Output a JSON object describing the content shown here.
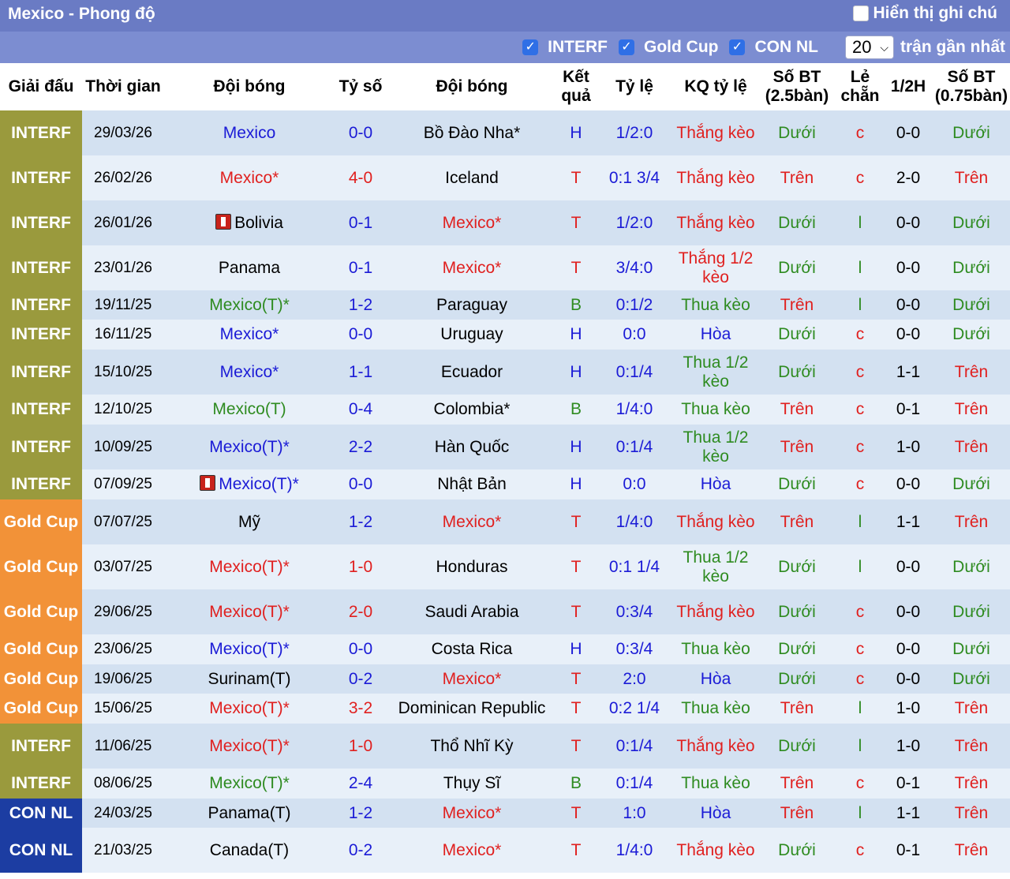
{
  "header": {
    "title": "Mexico - Phong độ",
    "notes_label": "Hiển thị ghi chú"
  },
  "filters": [
    {
      "label": "INTERF",
      "checked": true
    },
    {
      "label": "Gold Cup",
      "checked": true
    },
    {
      "label": "CON NL",
      "checked": true
    }
  ],
  "count": {
    "value": "20",
    "label": "trận gần nhất"
  },
  "columns": [
    "Giải đấu",
    "Thời gian",
    "Đội bóng",
    "Tỷ số",
    "Đội bóng",
    "Kết quả",
    "Tỷ lệ",
    "KQ tỷ lệ",
    "Số BT (2.5bàn)",
    "Lẻ chẵn",
    "1/2H",
    "Số BT (0.75bàn)"
  ],
  "colors": {
    "interf": "#9a9a3d",
    "gold": "#f29238",
    "connl": "#1c3da2",
    "blue": "#1b1bd6",
    "red": "#e0201f",
    "green": "#2e8b20"
  },
  "rows": [
    {
      "comp": "INTERF",
      "date": "29/03/26",
      "home": "Mexico",
      "home_color": "blue",
      "score": "0-0",
      "score_color": "blue",
      "away": "Bồ Đào Nha*",
      "away_color": "black",
      "result": "H",
      "result_color": "blue",
      "odds": "1/2:0",
      "odds_color": "blue",
      "ah": "Thắng kèo",
      "ah_color": "red",
      "ou": "Dưới",
      "ou_color": "green",
      "oe": "c",
      "oe_color": "red",
      "ht": "0-0",
      "ou2": "Dưới",
      "ou2_color": "green"
    },
    {
      "comp": "INTERF",
      "date": "26/02/26",
      "home": "Mexico*",
      "home_color": "red",
      "score": "4-0",
      "score_color": "red",
      "away": "Iceland",
      "away_color": "black",
      "result": "T",
      "result_color": "red",
      "odds": "0:1 3/4",
      "odds_color": "blue",
      "ah": "Thắng kèo",
      "ah_color": "red",
      "ou": "Trên",
      "ou_color": "red",
      "oe": "c",
      "oe_color": "red",
      "ht": "2-0",
      "ou2": "Trên",
      "ou2_color": "red"
    },
    {
      "comp": "INTERF",
      "date": "26/01/26",
      "home": "Bolivia",
      "home_color": "black",
      "home_flag": true,
      "score": "0-1",
      "score_color": "blue",
      "away": "Mexico*",
      "away_color": "red",
      "result": "T",
      "result_color": "red",
      "odds": "1/2:0",
      "odds_color": "blue",
      "ah": "Thắng kèo",
      "ah_color": "red",
      "ou": "Dưới",
      "ou_color": "green",
      "oe": "l",
      "oe_color": "green",
      "ht": "0-0",
      "ou2": "Dưới",
      "ou2_color": "green"
    },
    {
      "comp": "INTERF",
      "date": "23/01/26",
      "home": "Panama",
      "home_color": "black",
      "score": "0-1",
      "score_color": "blue",
      "away": "Mexico*",
      "away_color": "red",
      "result": "T",
      "result_color": "red",
      "odds": "3/4:0",
      "odds_color": "blue",
      "ah": "Thắng 1/2 kèo",
      "ah_color": "red",
      "ou": "Dưới",
      "ou_color": "green",
      "oe": "l",
      "oe_color": "green",
      "ht": "0-0",
      "ou2": "Dưới",
      "ou2_color": "green"
    },
    {
      "comp": "INTERF",
      "date": "19/11/25",
      "home": "Mexico(T)*",
      "home_color": "green",
      "score": "1-2",
      "score_color": "blue",
      "away": "Paraguay",
      "away_color": "black",
      "result": "B",
      "result_color": "green",
      "odds": "0:1/2",
      "odds_color": "blue",
      "ah": "Thua kèo",
      "ah_color": "green",
      "ou": "Trên",
      "ou_color": "red",
      "oe": "l",
      "oe_color": "green",
      "ht": "0-0",
      "ou2": "Dưới",
      "ou2_color": "green"
    },
    {
      "comp": "INTERF",
      "date": "16/11/25",
      "home": "Mexico*",
      "home_color": "blue",
      "score": "0-0",
      "score_color": "blue",
      "away": "Uruguay",
      "away_color": "black",
      "result": "H",
      "result_color": "blue",
      "odds": "0:0",
      "odds_color": "blue",
      "ah": "Hòa",
      "ah_color": "blue",
      "ou": "Dưới",
      "ou_color": "green",
      "oe": "c",
      "oe_color": "red",
      "ht": "0-0",
      "ou2": "Dưới",
      "ou2_color": "green"
    },
    {
      "comp": "INTERF",
      "date": "15/10/25",
      "home": "Mexico*",
      "home_color": "blue",
      "score": "1-1",
      "score_color": "blue",
      "away": "Ecuador",
      "away_color": "black",
      "result": "H",
      "result_color": "blue",
      "odds": "0:1/4",
      "odds_color": "blue",
      "ah": "Thua 1/2 kèo",
      "ah_color": "green",
      "ou": "Dưới",
      "ou_color": "green",
      "oe": "c",
      "oe_color": "red",
      "ht": "1-1",
      "ou2": "Trên",
      "ou2_color": "red"
    },
    {
      "comp": "INTERF",
      "date": "12/10/25",
      "home": "Mexico(T)",
      "home_color": "green",
      "score": "0-4",
      "score_color": "blue",
      "away": "Colombia*",
      "away_color": "black",
      "result": "B",
      "result_color": "green",
      "odds": "1/4:0",
      "odds_color": "blue",
      "ah": "Thua kèo",
      "ah_color": "green",
      "ou": "Trên",
      "ou_color": "red",
      "oe": "c",
      "oe_color": "red",
      "ht": "0-1",
      "ou2": "Trên",
      "ou2_color": "red"
    },
    {
      "comp": "INTERF",
      "date": "10/09/25",
      "home": "Mexico(T)*",
      "home_color": "blue",
      "score": "2-2",
      "score_color": "blue",
      "away": "Hàn Quốc",
      "away_color": "black",
      "result": "H",
      "result_color": "blue",
      "odds": "0:1/4",
      "odds_color": "blue",
      "ah": "Thua 1/2 kèo",
      "ah_color": "green",
      "ou": "Trên",
      "ou_color": "red",
      "oe": "c",
      "oe_color": "red",
      "ht": "1-0",
      "ou2": "Trên",
      "ou2_color": "red"
    },
    {
      "comp": "INTERF",
      "date": "07/09/25",
      "home": "Mexico(T)*",
      "home_color": "blue",
      "home_flag": true,
      "score": "0-0",
      "score_color": "blue",
      "away": "Nhật Bản",
      "away_color": "black",
      "result": "H",
      "result_color": "blue",
      "odds": "0:0",
      "odds_color": "blue",
      "ah": "Hòa",
      "ah_color": "blue",
      "ou": "Dưới",
      "ou_color": "green",
      "oe": "c",
      "oe_color": "red",
      "ht": "0-0",
      "ou2": "Dưới",
      "ou2_color": "green"
    },
    {
      "comp": "Gold Cup",
      "date": "07/07/25",
      "home": "Mỹ",
      "home_color": "black",
      "score": "1-2",
      "score_color": "blue",
      "away": "Mexico*",
      "away_color": "red",
      "result": "T",
      "result_color": "red",
      "odds": "1/4:0",
      "odds_color": "blue",
      "ah": "Thắng kèo",
      "ah_color": "red",
      "ou": "Trên",
      "ou_color": "red",
      "oe": "l",
      "oe_color": "green",
      "ht": "1-1",
      "ou2": "Trên",
      "ou2_color": "red"
    },
    {
      "comp": "Gold Cup",
      "date": "03/07/25",
      "home": "Mexico(T)*",
      "home_color": "red",
      "score": "1-0",
      "score_color": "red",
      "away": "Honduras",
      "away_color": "black",
      "result": "T",
      "result_color": "red",
      "odds": "0:1 1/4",
      "odds_color": "blue",
      "ah": "Thua 1/2 kèo",
      "ah_color": "green",
      "ou": "Dưới",
      "ou_color": "green",
      "oe": "l",
      "oe_color": "green",
      "ht": "0-0",
      "ou2": "Dưới",
      "ou2_color": "green"
    },
    {
      "comp": "Gold Cup",
      "date": "29/06/25",
      "home": "Mexico(T)*",
      "home_color": "red",
      "score": "2-0",
      "score_color": "red",
      "away": "Saudi Arabia",
      "away_color": "black",
      "result": "T",
      "result_color": "red",
      "odds": "0:3/4",
      "odds_color": "blue",
      "ah": "Thắng kèo",
      "ah_color": "red",
      "ou": "Dưới",
      "ou_color": "green",
      "oe": "c",
      "oe_color": "red",
      "ht": "0-0",
      "ou2": "Dưới",
      "ou2_color": "green"
    },
    {
      "comp": "Gold Cup",
      "date": "23/06/25",
      "home": "Mexico(T)*",
      "home_color": "blue",
      "score": "0-0",
      "score_color": "blue",
      "away": "Costa Rica",
      "away_color": "black",
      "result": "H",
      "result_color": "blue",
      "odds": "0:3/4",
      "odds_color": "blue",
      "ah": "Thua kèo",
      "ah_color": "green",
      "ou": "Dưới",
      "ou_color": "green",
      "oe": "c",
      "oe_color": "red",
      "ht": "0-0",
      "ou2": "Dưới",
      "ou2_color": "green"
    },
    {
      "comp": "Gold Cup",
      "date": "19/06/25",
      "home": "Surinam(T)",
      "home_color": "black",
      "score": "0-2",
      "score_color": "blue",
      "away": "Mexico*",
      "away_color": "red",
      "result": "T",
      "result_color": "red",
      "odds": "2:0",
      "odds_color": "blue",
      "ah": "Hòa",
      "ah_color": "blue",
      "ou": "Dưới",
      "ou_color": "green",
      "oe": "c",
      "oe_color": "red",
      "ht": "0-0",
      "ou2": "Dưới",
      "ou2_color": "green"
    },
    {
      "comp": "Gold Cup",
      "date": "15/06/25",
      "home": "Mexico(T)*",
      "home_color": "red",
      "score": "3-2",
      "score_color": "red",
      "away": "Dominican Republic",
      "away_color": "black",
      "result": "T",
      "result_color": "red",
      "odds": "0:2 1/4",
      "odds_color": "blue",
      "ah": "Thua kèo",
      "ah_color": "green",
      "ou": "Trên",
      "ou_color": "red",
      "oe": "l",
      "oe_color": "green",
      "ht": "1-0",
      "ou2": "Trên",
      "ou2_color": "red"
    },
    {
      "comp": "INTERF",
      "date": "11/06/25",
      "home": "Mexico(T)*",
      "home_color": "red",
      "score": "1-0",
      "score_color": "red",
      "away": "Thổ Nhĩ Kỳ",
      "away_color": "black",
      "result": "T",
      "result_color": "red",
      "odds": "0:1/4",
      "odds_color": "blue",
      "ah": "Thắng kèo",
      "ah_color": "red",
      "ou": "Dưới",
      "ou_color": "green",
      "oe": "l",
      "oe_color": "green",
      "ht": "1-0",
      "ou2": "Trên",
      "ou2_color": "red"
    },
    {
      "comp": "INTERF",
      "date": "08/06/25",
      "home": "Mexico(T)*",
      "home_color": "green",
      "score": "2-4",
      "score_color": "blue",
      "away": "Thụy Sĩ",
      "away_color": "black",
      "result": "B",
      "result_color": "green",
      "odds": "0:1/4",
      "odds_color": "blue",
      "ah": "Thua kèo",
      "ah_color": "green",
      "ou": "Trên",
      "ou_color": "red",
      "oe": "c",
      "oe_color": "red",
      "ht": "0-1",
      "ou2": "Trên",
      "ou2_color": "red"
    },
    {
      "comp": "CON NL",
      "date": "24/03/25",
      "home": "Panama(T)",
      "home_color": "black",
      "score": "1-2",
      "score_color": "blue",
      "away": "Mexico*",
      "away_color": "red",
      "result": "T",
      "result_color": "red",
      "odds": "1:0",
      "odds_color": "blue",
      "ah": "Hòa",
      "ah_color": "blue",
      "ou": "Trên",
      "ou_color": "red",
      "oe": "l",
      "oe_color": "green",
      "ht": "1-1",
      "ou2": "Trên",
      "ou2_color": "red"
    },
    {
      "comp": "CON NL",
      "date": "21/03/25",
      "home": "Canada(T)",
      "home_color": "black",
      "score": "0-2",
      "score_color": "blue",
      "away": "Mexico*",
      "away_color": "red",
      "result": "T",
      "result_color": "red",
      "odds": "1/4:0",
      "odds_color": "blue",
      "ah": "Thắng kèo",
      "ah_color": "red",
      "ou": "Dưới",
      "ou_color": "green",
      "oe": "c",
      "oe_color": "red",
      "ht": "0-1",
      "ou2": "Trên",
      "ou2_color": "red"
    }
  ]
}
